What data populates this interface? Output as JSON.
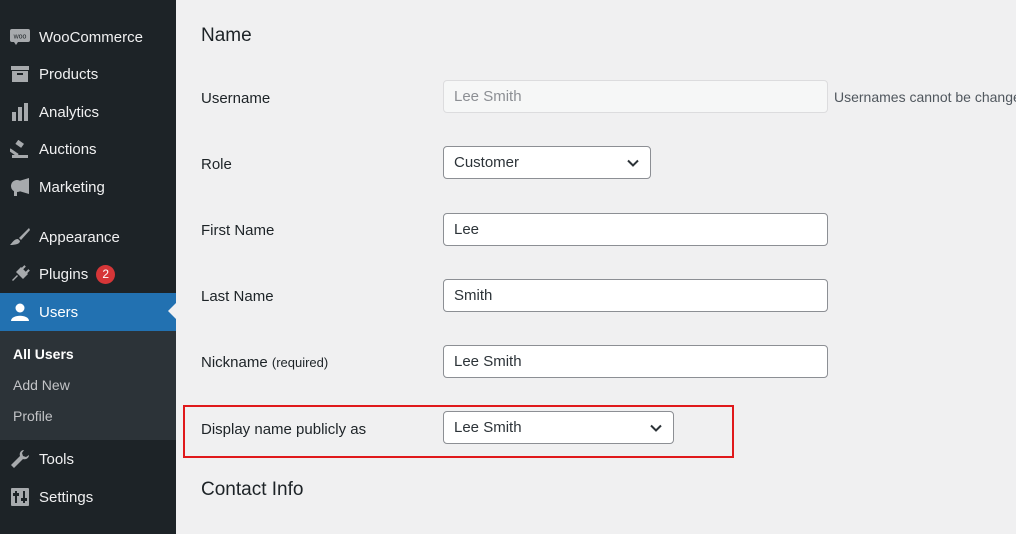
{
  "sidebar": {
    "items": [
      {
        "label": "WooCommerce",
        "icon": "woo-icon"
      },
      {
        "label": "Products",
        "icon": "archive-icon"
      },
      {
        "label": "Analytics",
        "icon": "bar-chart-icon"
      },
      {
        "label": "Auctions",
        "icon": "gavel-icon"
      },
      {
        "label": "Marketing",
        "icon": "megaphone-icon"
      },
      {
        "label": "Appearance",
        "icon": "paintbrush-icon"
      },
      {
        "label": "Plugins",
        "icon": "plugin-icon",
        "badge": "2"
      },
      {
        "label": "Users",
        "icon": "user-icon"
      },
      {
        "label": "Tools",
        "icon": "wrench-icon"
      },
      {
        "label": "Settings",
        "icon": "settings-icon"
      }
    ],
    "woo_icon_text": "woo",
    "submenu": [
      "All Users",
      "Add New",
      "Profile"
    ]
  },
  "form": {
    "name_heading": "Name",
    "username": {
      "label": "Username",
      "value": "Lee Smith",
      "description": "Usernames cannot be changed."
    },
    "role": {
      "label": "Role",
      "value": "Customer"
    },
    "first_name": {
      "label": "First Name",
      "value": "Lee"
    },
    "last_name": {
      "label": "Last Name",
      "value": "Smith"
    },
    "nickname": {
      "label": "Nickname",
      "required": "(required)",
      "value": "Lee Smith"
    },
    "display_name": {
      "label": "Display name publicly as",
      "value": "Lee Smith"
    },
    "contact_heading": "Contact Info"
  },
  "colors": {
    "sidebar_bg": "#1d2327",
    "active": "#2271b1",
    "highlight": "#e0191b",
    "badge": "#d63638"
  }
}
